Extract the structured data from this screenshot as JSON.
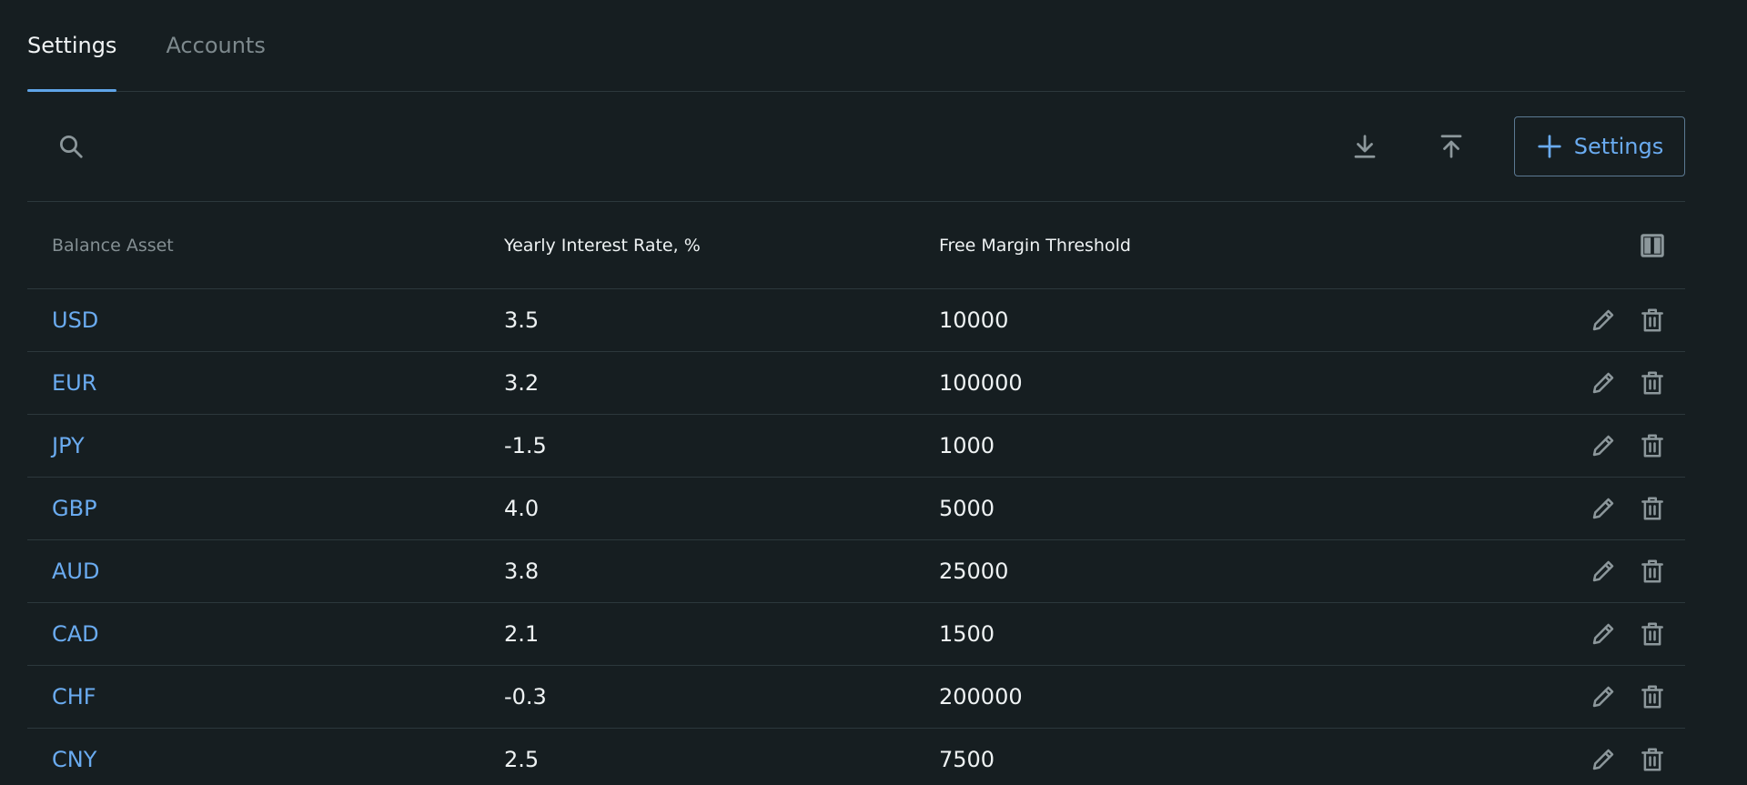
{
  "tabs": [
    {
      "label": "Settings",
      "active": true
    },
    {
      "label": "Accounts",
      "active": false
    }
  ],
  "toolbar": {
    "search_icon": "search-icon",
    "download_icon": "download-icon",
    "upload_icon": "upload-icon",
    "add_button_label": "Settings",
    "add_icon": "plus-icon"
  },
  "table": {
    "columns": [
      "Balance Asset",
      "Yearly Interest Rate, %",
      "Free Margin Threshold"
    ],
    "column_toggle_icon": "columns-icon",
    "rows": [
      {
        "asset": "USD",
        "rate": "3.5",
        "threshold": "10000"
      },
      {
        "asset": "EUR",
        "rate": "3.2",
        "threshold": "100000"
      },
      {
        "asset": "JPY",
        "rate": "-1.5",
        "threshold": "1000"
      },
      {
        "asset": "GBP",
        "rate": "4.0",
        "threshold": "5000"
      },
      {
        "asset": "AUD",
        "rate": "3.8",
        "threshold": "25000"
      },
      {
        "asset": "CAD",
        "rate": "2.1",
        "threshold": "1500"
      },
      {
        "asset": "CHF",
        "rate": "-0.3",
        "threshold": "200000"
      },
      {
        "asset": "CNY",
        "rate": "2.5",
        "threshold": "7500"
      }
    ],
    "row_actions": [
      "edit-icon",
      "delete-icon"
    ]
  },
  "colors": {
    "background": "#161e21",
    "accent": "#6aabf0",
    "divider": "#2c383c",
    "muted_text": "#848f93"
  }
}
